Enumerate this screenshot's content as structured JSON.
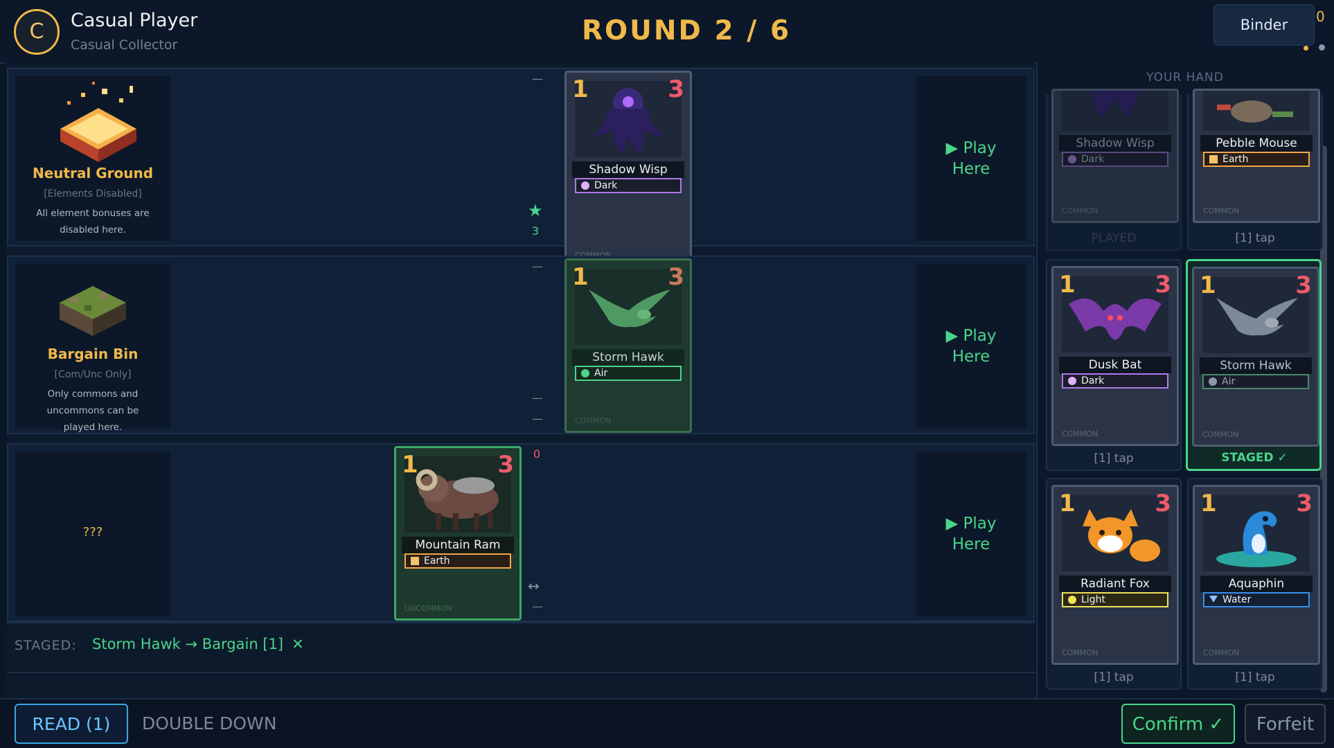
{
  "header": {
    "avatar_letter": "C",
    "player_name": "Casual Player",
    "player_title": "Casual Collector",
    "round_label": "ROUND  2 / 6",
    "binder_label": "Binder",
    "binder_count_fragment": "0"
  },
  "lanes": [
    {
      "location": {
        "name": "Neutral Ground",
        "tag": "[Elements Disabled]",
        "desc": "All element bonuses are disabled here."
      },
      "markers": {
        "top": "—",
        "star_count": "3"
      },
      "opponent_card": {
        "cost": "1",
        "power": "3",
        "name": "Shadow Wisp",
        "element": "Dark",
        "rarity": "COMMON"
      },
      "play_label_1": "▶ Play",
      "play_label_2": "Here"
    },
    {
      "location": {
        "name": "Bargain Bin",
        "tag": "[Com/Unc Only]",
        "desc": "Only commons and uncommons can be played here."
      },
      "markers": {
        "top": "—",
        "mid": "—",
        "bottom": "—"
      },
      "opponent_card": {
        "cost": "1",
        "power": "3",
        "name": "Storm Hawk",
        "element": "Air",
        "rarity": "COMMON"
      },
      "play_label_1": "▶ Play",
      "play_label_2": "Here"
    },
    {
      "location": {
        "name": "???"
      },
      "markers": {
        "zero": "0",
        "swap": "↔",
        "bottom": "—"
      },
      "player_card": {
        "cost": "1",
        "power": "3",
        "name": "Mountain Ram",
        "element": "Earth",
        "rarity": "UNCOMMON"
      },
      "play_label_1": "▶ Play",
      "play_label_2": "Here"
    }
  ],
  "staged": {
    "label": "STAGED:",
    "text": "Storm Hawk → Bargain  [1]",
    "remove": "✕"
  },
  "hand": {
    "title": "YOUR HAND",
    "cards": [
      {
        "name": "Shadow Wisp",
        "element": "Dark",
        "rarity": "COMMON",
        "status": "PLAYED"
      },
      {
        "name": "Pebble Mouse",
        "element": "Earth",
        "rarity": "COMMON",
        "status": "[1] tap"
      },
      {
        "cost": "1",
        "power": "3",
        "name": "Dusk Bat",
        "element": "Dark",
        "rarity": "COMMON",
        "status": "[1] tap"
      },
      {
        "cost": "1",
        "power": "3",
        "name": "Storm Hawk",
        "element": "Air",
        "rarity": "COMMON",
        "status": "STAGED ✓"
      },
      {
        "cost": "1",
        "power": "3",
        "name": "Radiant Fox",
        "element": "Light",
        "rarity": "COMMON",
        "status": "[1] tap"
      },
      {
        "cost": "1",
        "power": "3",
        "name": "Aquaphin",
        "element": "Water",
        "rarity": "COMMON",
        "status": "[1] tap"
      }
    ]
  },
  "actions": {
    "read": "READ (1)",
    "double_down": "DOUBLE DOWN",
    "confirm": "Confirm ✓",
    "forfeit": "Forfeit"
  },
  "colors": {
    "gold": "#f0b94a",
    "green": "#4ad58a",
    "red": "#ef5b6a",
    "dark": "#c58cf2",
    "earth": "#f2c46a",
    "air": "#4ad58a",
    "light": "#f2e25a",
    "water": "#3a8ef0"
  }
}
